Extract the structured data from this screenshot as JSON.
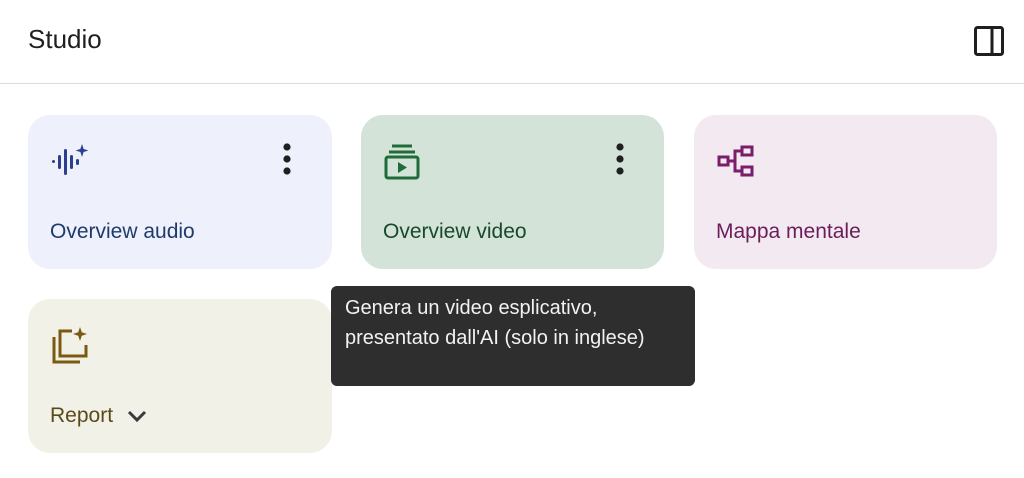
{
  "header": {
    "title": "Studio",
    "toggle_icon": "side-panel-icon"
  },
  "cards": {
    "audio": {
      "label": "Overview audio",
      "icon": "audio-waveform-sparkle-icon",
      "bg": "#eef0fb",
      "color": "#1f3a6b",
      "icon_color": "#2b3f8f"
    },
    "video": {
      "label": "Overview video",
      "icon": "video-play-stack-icon",
      "bg": "#d3e3d7",
      "color": "#17492a",
      "icon_color": "#1f6b39"
    },
    "mind_map": {
      "label": "Mappa mentale",
      "icon": "mind-map-icon",
      "bg": "#f3e9f1",
      "color": "#6b1d5b",
      "icon_color": "#7a1d6b"
    },
    "report": {
      "label": "Report",
      "icon": "report-sparkle-icon",
      "bg": "#f2f1e8",
      "color": "#5a4a1a",
      "icon_color": "#7a5a10"
    }
  },
  "tooltip": {
    "text": "Genera un video esplicativo, presentato dall'AI (solo in inglese)"
  }
}
